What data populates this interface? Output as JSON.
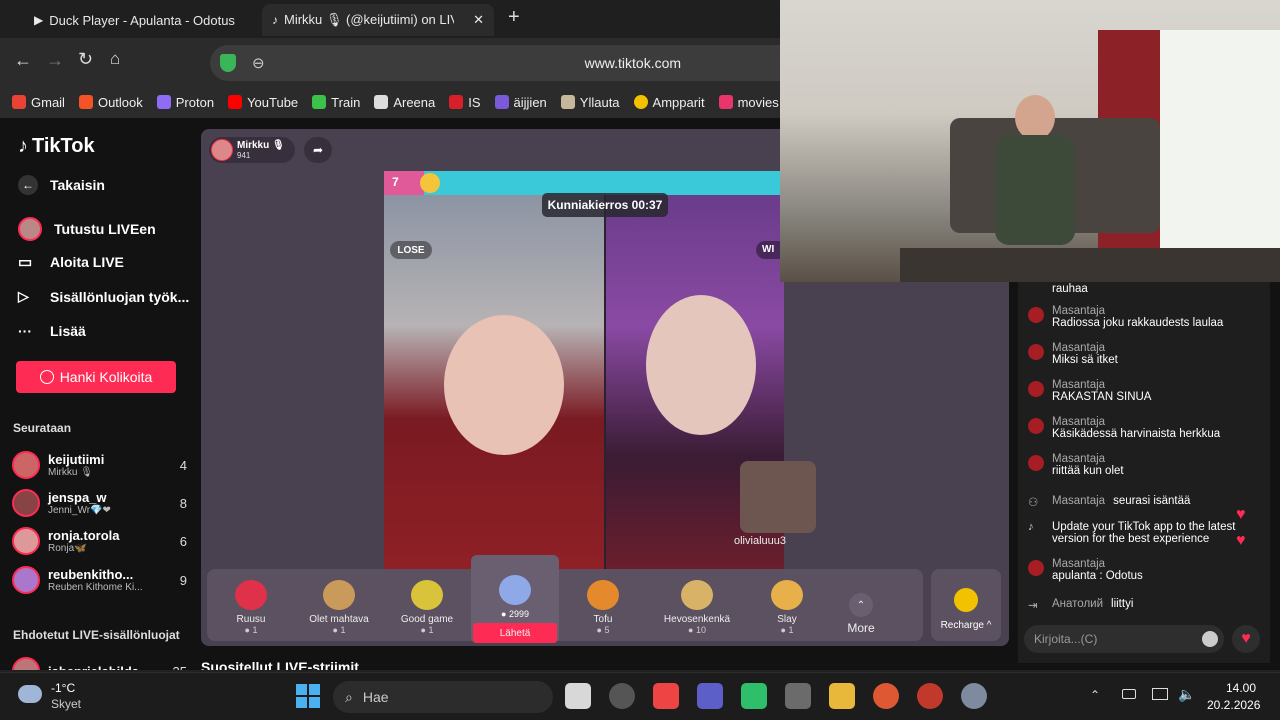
{
  "tabs": [
    {
      "label": "Duck Player - Apulanta - Odotus",
      "icon": "duck-player-icon"
    },
    {
      "label": "Mirkku 🎙 (@keijutiimi) on LIV",
      "icon": "tiktok-icon"
    }
  ],
  "url": "www.tiktok.com",
  "bookmarks": [
    "Gmail",
    "Outlook",
    "Proton",
    "YouTube",
    "Train",
    "Areena",
    "IS",
    "äijjien",
    "Yllauta",
    "Ampparit",
    "movies"
  ],
  "sidebar": {
    "logo": "TikTok",
    "back": "Takaisin",
    "nav": [
      "Tutustu LIVEen",
      "Aloita LIVE",
      "Sisällönluojan työk...",
      "Lisää"
    ],
    "coins_button": "Hanki Kolikoita",
    "following_title": "Seurataan",
    "following": [
      {
        "name": "keijutiimi",
        "sub": "Mirkku 🎙",
        "count": "4"
      },
      {
        "name": "jenspa_w",
        "sub": "Jenni_Wr💎❤",
        "count": "8"
      },
      {
        "name": "ronja.torola",
        "sub": "Ronja🦋",
        "count": "6"
      },
      {
        "name": "reubenkitho...",
        "sub": "Reuben Kithome Ki...",
        "count": "9"
      }
    ],
    "suggested_title": "Ehdotetut LIVE-sisällönluojat",
    "suggested_first": "isbeprielahilda",
    "suggested_count": "35"
  },
  "stream": {
    "host_name": "Mirkku 🎙",
    "host_likes": "941",
    "battle_score_left": "7",
    "timer": "Kunniakierros 00:37",
    "lose_label": "LOSE",
    "win_label": "WI",
    "guest_name": "olivialuuu3",
    "recommended": "Suositellut LIVE-striimit"
  },
  "gifts": [
    {
      "name": "Ruusu",
      "cost": "1",
      "color": "#e0314a"
    },
    {
      "name": "Olet mahtava",
      "cost": "1",
      "color": "#c99a5a"
    },
    {
      "name": "Good game",
      "cost": "1",
      "color": "#d9c33a"
    },
    {
      "name": "",
      "cost": "2999",
      "color": "#8fa8e8",
      "button": "Lähetä"
    },
    {
      "name": "Tofu",
      "cost": "5",
      "color": "#e58a2c"
    },
    {
      "name": "Hevosenkenkä",
      "cost": "10",
      "color": "#d8b266"
    },
    {
      "name": "Slay",
      "cost": "1",
      "color": "#e8b04a"
    }
  ],
  "more_label": "More",
  "recharge_label": "Recharge ^",
  "chat": {
    "messages": [
      {
        "user": "",
        "text": "rauhaa"
      },
      {
        "user": "Masantaja",
        "text": "Radiossa joku rakkaudests laulaa"
      },
      {
        "user": "Masantaja",
        "text": "Miksi sä itket"
      },
      {
        "user": "Masantaja",
        "text": "RAKASTAN SINUA"
      },
      {
        "user": "Masantaja",
        "text": "Käsikädessä harvinaista herkkua"
      },
      {
        "user": "Masantaja",
        "text": "riittää kun olet"
      }
    ],
    "follow_notice": {
      "user": "Masantaja",
      "text": "seurasi isäntää"
    },
    "update_notice": "Update your TikTok app to the latest version for the best experience",
    "last_message": {
      "user": "Masantaja",
      "text": "apulanta : Odotus"
    },
    "join_notice": {
      "user": "Анатолий",
      "text": "liittyi"
    },
    "input_placeholder": "Kirjoita...(C)"
  },
  "taskbar": {
    "weather_temp": "-1°C",
    "weather_desc": "Skyet",
    "search": "Hae",
    "time": "14.00",
    "date": "20.2.2026"
  }
}
